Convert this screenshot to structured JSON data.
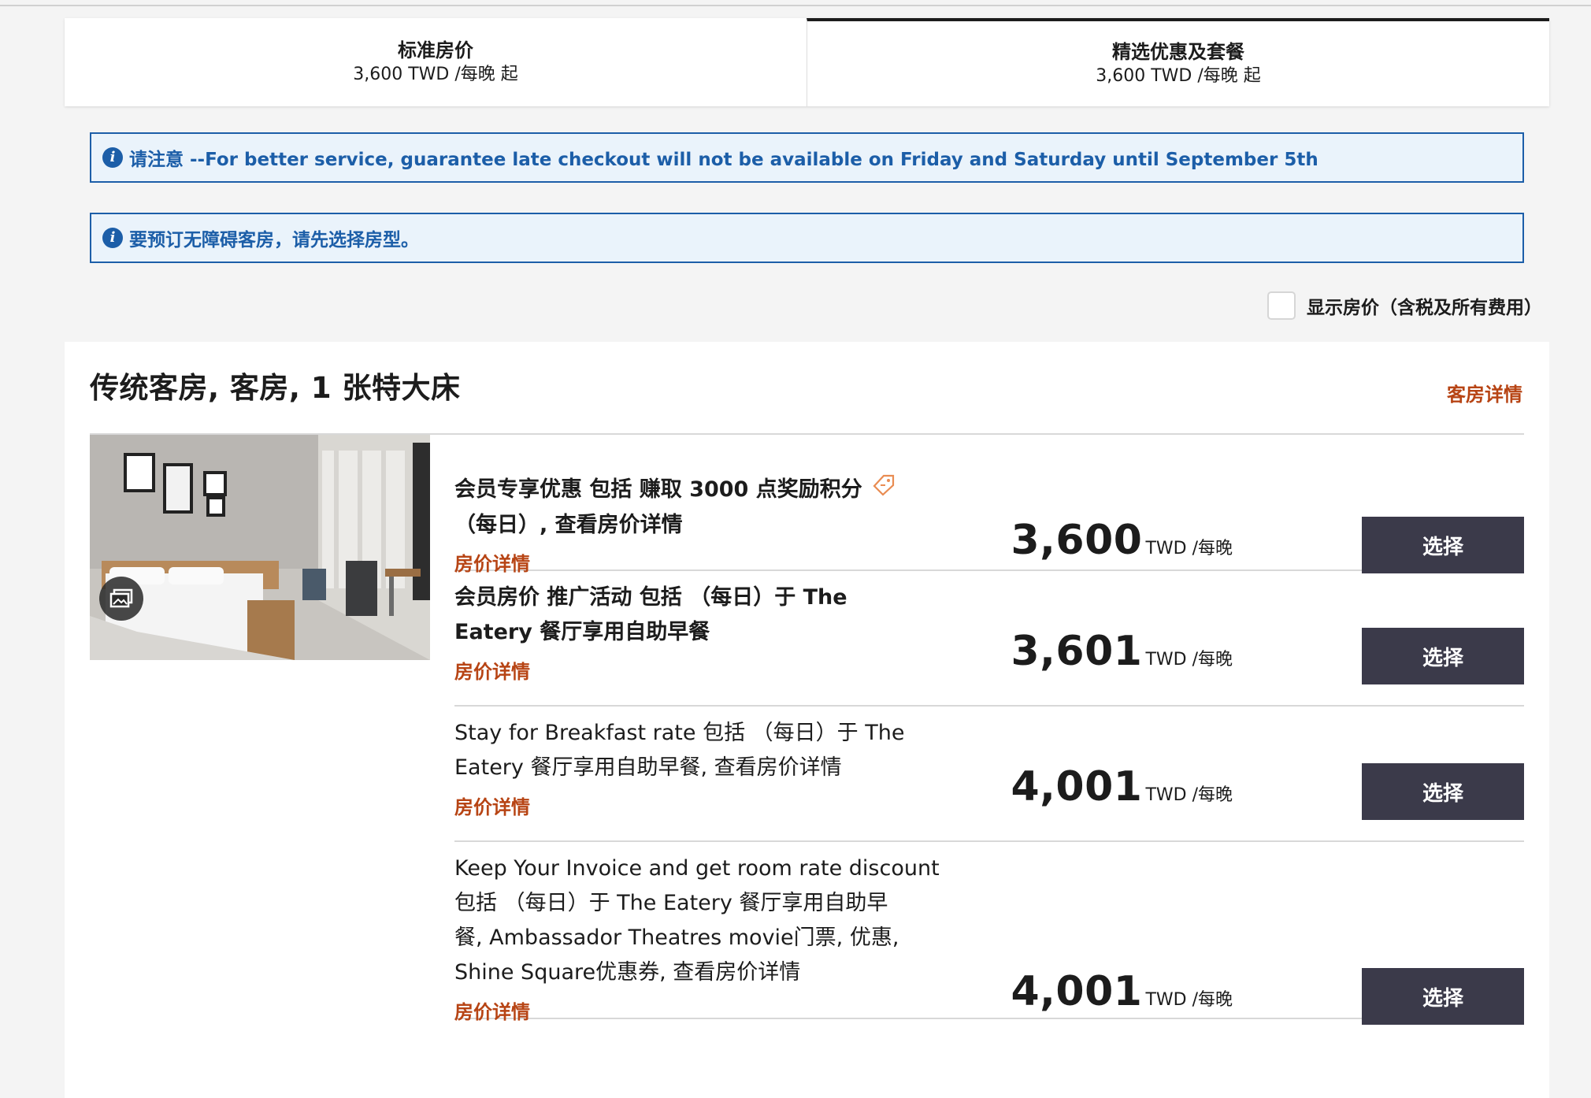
{
  "tabs": [
    {
      "title": "标准房价",
      "price": "3,600 TWD /每晚 起"
    },
    {
      "title": "精选优惠及套餐",
      "price": "3,600 TWD /每晚 起"
    }
  ],
  "notices": [
    "请注意 --For better service, guarantee late checkout will not be available on Friday and Saturday until September 5th",
    "要预订无障碍客房，请先选择房型。"
  ],
  "tax_toggle_label": "显示房价（含税及所有费用）",
  "room": {
    "title": "传统客房, 客房, 1 张特大床",
    "details_link": "客房详情",
    "rates": [
      {
        "line1": "会员专享优惠 包括 赚取 3000 点奖励积分",
        "line2": "（每日）, 查看房价详情",
        "link": "房价详情",
        "amount": "3,600",
        "unit": "TWD /每晚",
        "button": "选择"
      },
      {
        "line1": "会员房价 推广活动 包括 （每日）于 The",
        "line2": "Eatery 餐厅享用自助早餐",
        "link": "房价详情",
        "amount": "3,601",
        "unit": "TWD /每晚",
        "button": "选择"
      },
      {
        "line1": "Stay for Breakfast rate 包括 （每日）于 The",
        "line2": "Eatery 餐厅享用自助早餐, 查看房价详情",
        "link": "房价详情",
        "amount": "4,001",
        "unit": "TWD /每晚",
        "button": "选择"
      },
      {
        "line1": "Keep Your Invoice and get room rate discount",
        "line2": "包括 （每日）于 The Eatery 餐厅享用自助早",
        "line3": "餐, Ambassador Theatres movie门票, 优惠,",
        "line4": "Shine Square优惠券, 查看房价详情",
        "link": "房价详情",
        "amount": "4,001",
        "unit": "TWD /每晚",
        "button": "选择"
      }
    ]
  }
}
